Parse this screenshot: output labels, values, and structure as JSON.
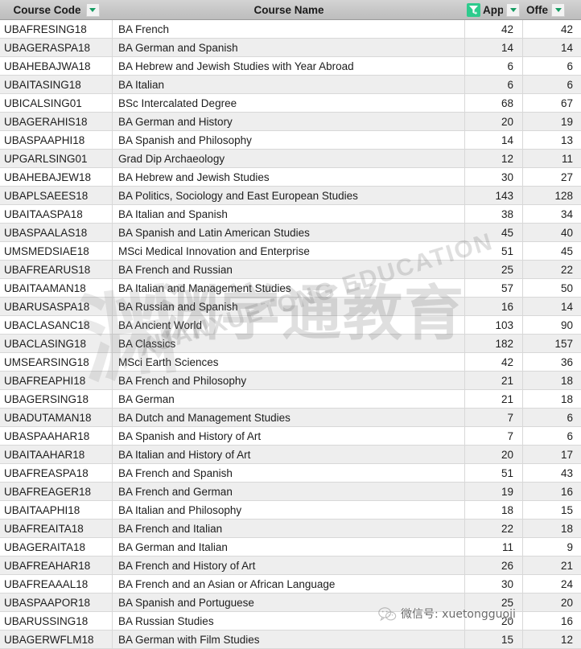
{
  "table": {
    "columns": [
      {
        "key": "course_code",
        "label": "Course Code",
        "has_filter": false,
        "has_dropdown": true
      },
      {
        "key": "course_name",
        "label": "Course Name",
        "has_filter": false,
        "has_dropdown": false
      },
      {
        "key": "applications",
        "label": "Applicatio",
        "has_filter": true,
        "has_dropdown": true
      },
      {
        "key": "offers",
        "label": "Offe",
        "has_filter": true,
        "has_dropdown": true
      }
    ],
    "rows": [
      {
        "course_code": "UBAFRESING18",
        "course_name": "BA French",
        "applications": "42",
        "offers": "42"
      },
      {
        "course_code": "UBAGERASPA18",
        "course_name": "BA German and Spanish",
        "applications": "14",
        "offers": "14"
      },
      {
        "course_code": "UBAHEBAJWA18",
        "course_name": "BA Hebrew and Jewish Studies with Year Abroad",
        "applications": "6",
        "offers": "6"
      },
      {
        "course_code": "UBAITASING18",
        "course_name": "BA Italian",
        "applications": "6",
        "offers": "6"
      },
      {
        "course_code": "UBICALSING01",
        "course_name": "BSc Intercalated Degree",
        "applications": "68",
        "offers": "67"
      },
      {
        "course_code": "UBAGERAHIS18",
        "course_name": "BA German and History",
        "applications": "20",
        "offers": "19"
      },
      {
        "course_code": "UBASPAAPHI18",
        "course_name": "BA Spanish and Philosophy",
        "applications": "14",
        "offers": "13"
      },
      {
        "course_code": "UPGARLSING01",
        "course_name": "Grad Dip Archaeology",
        "applications": "12",
        "offers": "11"
      },
      {
        "course_code": "UBAHEBAJEW18",
        "course_name": "BA Hebrew and Jewish Studies",
        "applications": "30",
        "offers": "27"
      },
      {
        "course_code": "UBAPLSAEES18",
        "course_name": "BA Politics, Sociology and East European Studies",
        "applications": "143",
        "offers": "128"
      },
      {
        "course_code": "UBAITAASPA18",
        "course_name": "BA Italian and Spanish",
        "applications": "38",
        "offers": "34"
      },
      {
        "course_code": "UBASPAALAS18",
        "course_name": "BA Spanish and Latin American Studies",
        "applications": "45",
        "offers": "40"
      },
      {
        "course_code": "UMSMEDSIAE18",
        "course_name": "MSci Medical Innovation and Enterprise",
        "applications": "51",
        "offers": "45"
      },
      {
        "course_code": "UBAFREARUS18",
        "course_name": "BA French and Russian",
        "applications": "25",
        "offers": "22"
      },
      {
        "course_code": "UBAITAAMAN18",
        "course_name": "BA Italian and Management Studies",
        "applications": "57",
        "offers": "50"
      },
      {
        "course_code": "UBARUSASPA18",
        "course_name": "BA Russian and Spanish",
        "applications": "16",
        "offers": "14"
      },
      {
        "course_code": "UBACLASANC18",
        "course_name": "BA Ancient World",
        "applications": "103",
        "offers": "90"
      },
      {
        "course_code": "UBACLASING18",
        "course_name": "BA Classics",
        "applications": "182",
        "offers": "157"
      },
      {
        "course_code": "UMSEARSING18",
        "course_name": "MSci Earth Sciences",
        "applications": "42",
        "offers": "36"
      },
      {
        "course_code": "UBAFREAPHI18",
        "course_name": "BA French and Philosophy",
        "applications": "21",
        "offers": "18"
      },
      {
        "course_code": "UBAGERSING18",
        "course_name": "BA German",
        "applications": "21",
        "offers": "18"
      },
      {
        "course_code": "UBADUTAMAN18",
        "course_name": "BA Dutch and Management Studies",
        "applications": "7",
        "offers": "6"
      },
      {
        "course_code": "UBASPAAHAR18",
        "course_name": "BA Spanish and History of Art",
        "applications": "7",
        "offers": "6"
      },
      {
        "course_code": "UBAITAAHAR18",
        "course_name": "BA Italian and History of Art",
        "applications": "20",
        "offers": "17"
      },
      {
        "course_code": "UBAFREASPA18",
        "course_name": "BA French and Spanish",
        "applications": "51",
        "offers": "43"
      },
      {
        "course_code": "UBAFREAGER18",
        "course_name": "BA French and German",
        "applications": "19",
        "offers": "16"
      },
      {
        "course_code": "UBAITAAPHI18",
        "course_name": "BA Italian and Philosophy",
        "applications": "18",
        "offers": "15"
      },
      {
        "course_code": "UBAFREAITA18",
        "course_name": "BA French and Italian",
        "applications": "22",
        "offers": "18"
      },
      {
        "course_code": "UBAGERAITA18",
        "course_name": "BA German and Italian",
        "applications": "11",
        "offers": "9"
      },
      {
        "course_code": "UBAFREAHAR18",
        "course_name": "BA French and History of Art",
        "applications": "26",
        "offers": "21"
      },
      {
        "course_code": "UBAFREAAAL18",
        "course_name": "BA French and an Asian or African Language",
        "applications": "30",
        "offers": "24"
      },
      {
        "course_code": "UBASPAAPOR18",
        "course_name": "BA Spanish and Portuguese",
        "applications": "25",
        "offers": "20"
      },
      {
        "course_code": "UBARUSSING18",
        "course_name": "BA Russian Studies",
        "applications": "20",
        "offers": "16"
      },
      {
        "course_code": "UBAGERWFLM18",
        "course_name": "BA German with Film Studies",
        "applications": "15",
        "offers": "12"
      }
    ]
  },
  "watermark": {
    "main_cn": "渊学通教育",
    "main_en": "XUANXUETONG EDUCATION",
    "logo_glyph": "渊",
    "badge_text": "微信号: xuetongguoji"
  },
  "colors": {
    "filter_green": "#2ecb8d",
    "dropdown_green": "#169c62",
    "header_grey": "#c6c6c6",
    "row_alt": "#eeeeee"
  }
}
